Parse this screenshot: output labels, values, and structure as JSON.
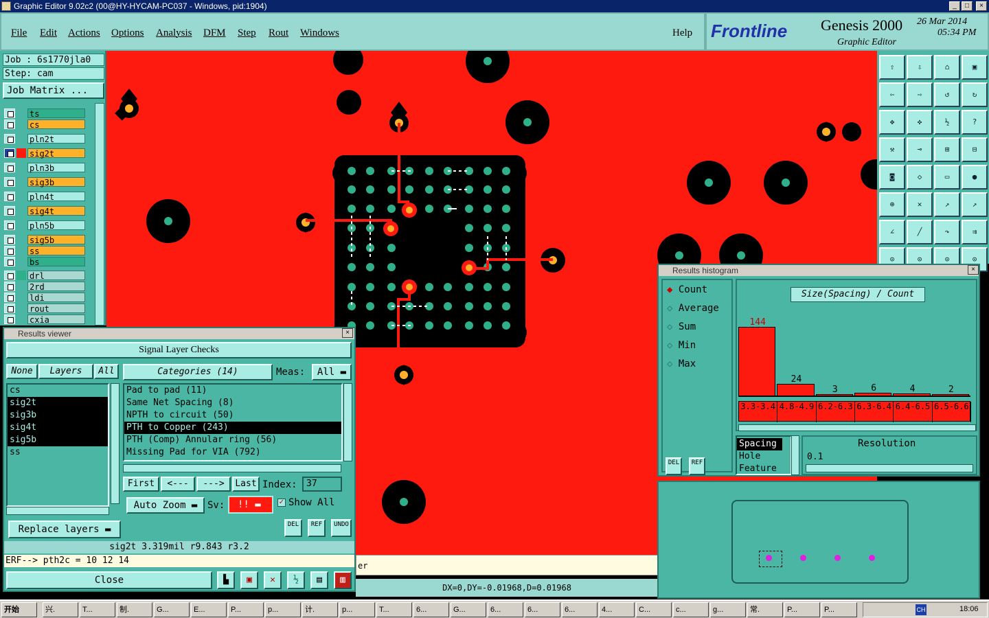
{
  "window": {
    "title": "Graphic Editor 9.02c2 (00@HY-HYCAM-PC037 - Windows, pid:1904)",
    "buttons": [
      "_",
      "□",
      "×"
    ]
  },
  "menu": [
    "File",
    "Edit",
    "Actions",
    "Options",
    "Analysis",
    "DFM",
    "Step",
    "Rout",
    "Windows"
  ],
  "help": "Help",
  "brand": {
    "logo": "Frontline",
    "product": "Genesis 2000",
    "subtitle": "Graphic Editor",
    "date": "26 Mar 2014",
    "time": "05:34 PM"
  },
  "job": {
    "job_label": "Job : 6s1770jla0",
    "step_label": "Step: cam",
    "matrix_button": "Job Matrix ..."
  },
  "layers": [
    {
      "name": "ts",
      "color": "#2fb08a"
    },
    {
      "name": "cs",
      "color": "#ffb12a"
    },
    {
      "name": "pln2t",
      "color": "#a8ece3"
    },
    {
      "name": "sig2t",
      "color": "#ffb12a"
    },
    {
      "name": "pln3b",
      "color": "#a8ece3"
    },
    {
      "name": "sig3b",
      "color": "#ffb12a"
    },
    {
      "name": "pln4t",
      "color": "#a8ece3"
    },
    {
      "name": "sig4t",
      "color": "#ffb12a"
    },
    {
      "name": "pln5b",
      "color": "#a8ece3"
    },
    {
      "name": "sig5b",
      "color": "#ffb12a"
    },
    {
      "name": "ss",
      "color": "#ffb12a"
    },
    {
      "name": "bs",
      "color": "#2fb08a"
    },
    {
      "name": "drl",
      "color": "#a8d8d0"
    },
    {
      "name": "2rd",
      "color": "#a8d8d0"
    },
    {
      "name": "ldi",
      "color": "#a8d8d0"
    },
    {
      "name": "rout",
      "color": "#a8d8d0"
    },
    {
      "name": "cxia",
      "color": "#a8d8d0"
    }
  ],
  "results_viewer": {
    "title": "Results viewer",
    "header": "Signal Layer Checks",
    "none_btn": "None",
    "layers_btn": "Layers",
    "all_btn": "All",
    "layer_list": [
      {
        "name": "cs",
        "selected": false
      },
      {
        "name": "sig2t",
        "selected": true
      },
      {
        "name": "sig3b",
        "selected": true
      },
      {
        "name": "sig4t",
        "selected": true
      },
      {
        "name": "sig5b",
        "selected": true
      },
      {
        "name": "ss",
        "selected": false
      }
    ],
    "categories_btn": "Categories (14)",
    "meas_label": "Meas:",
    "meas_value": "All",
    "categories": [
      {
        "name": "Pad to pad (11)",
        "selected": false
      },
      {
        "name": "Same Net Spacing (8)",
        "selected": false
      },
      {
        "name": "NPTH to circuit (50)",
        "selected": false
      },
      {
        "name": "PTH to Copper (243)",
        "selected": true
      },
      {
        "name": "PTH (Comp) Annular ring (56)",
        "selected": false
      },
      {
        "name": "Missing Pad for VIA (792)",
        "selected": false
      }
    ],
    "first": "First",
    "prev": "<---",
    "next": "--->",
    "last": "Last",
    "index_label": "Index:",
    "index_value": "37",
    "auto_zoom": "Auto Zoom",
    "sv_label": "Sv:",
    "sv_value": "!!",
    "show_all": "Show All",
    "del": "DEL",
    "ref": "REF",
    "undo": "UNDO",
    "replace_layers": "Replace layers",
    "measurement": "sig2t 3.319mil   r9.843   r3.2",
    "erf": "ERF--> pth2c = 10 12 14",
    "close": "Close"
  },
  "histogram": {
    "title": "Results histogram",
    "modes": [
      "Count",
      "Average",
      "Sum",
      "Min",
      "Max"
    ],
    "active_mode": "Count",
    "chart_title": "Size(Spacing) / Count",
    "del": "DEL",
    "ref": "REF",
    "param_list": [
      "Spacing",
      "Hole",
      "Feature"
    ],
    "resolution_label": "Resolution",
    "resolution_value": "0.1"
  },
  "chart_data": {
    "type": "bar",
    "title": "Size(Spacing) / Count",
    "categories": [
      "3.3-3.4",
      "4.8-4.9",
      "6.2-6.3",
      "6.3-6.4",
      "6.4-6.5",
      "6.5-6.6"
    ],
    "values": [
      144,
      24,
      3,
      6,
      4,
      2
    ],
    "ylim": [
      0,
      144
    ],
    "color": "#ff1a10"
  },
  "status": {
    "text": "er",
    "coords": "DX=0,DY=-0.01968,D=0.01968"
  },
  "taskbar": {
    "start": "开始",
    "items": [
      "兴.",
      "T...",
      "制.",
      "G...",
      "E...",
      "P...",
      "p...",
      "计.",
      "p...",
      "T...",
      "6...",
      "G...",
      "6...",
      "6...",
      "6...",
      "4...",
      "C...",
      "c...",
      "g...",
      "常.",
      "P...",
      "P..."
    ],
    "tray_lang": "CH",
    "clock": "18:06"
  },
  "colors": {
    "panel": "#4bb6a4",
    "canvas": "#ff1a10",
    "copper_void": "#000000",
    "pad": "#2fb08a",
    "via": "#ffb12a"
  }
}
